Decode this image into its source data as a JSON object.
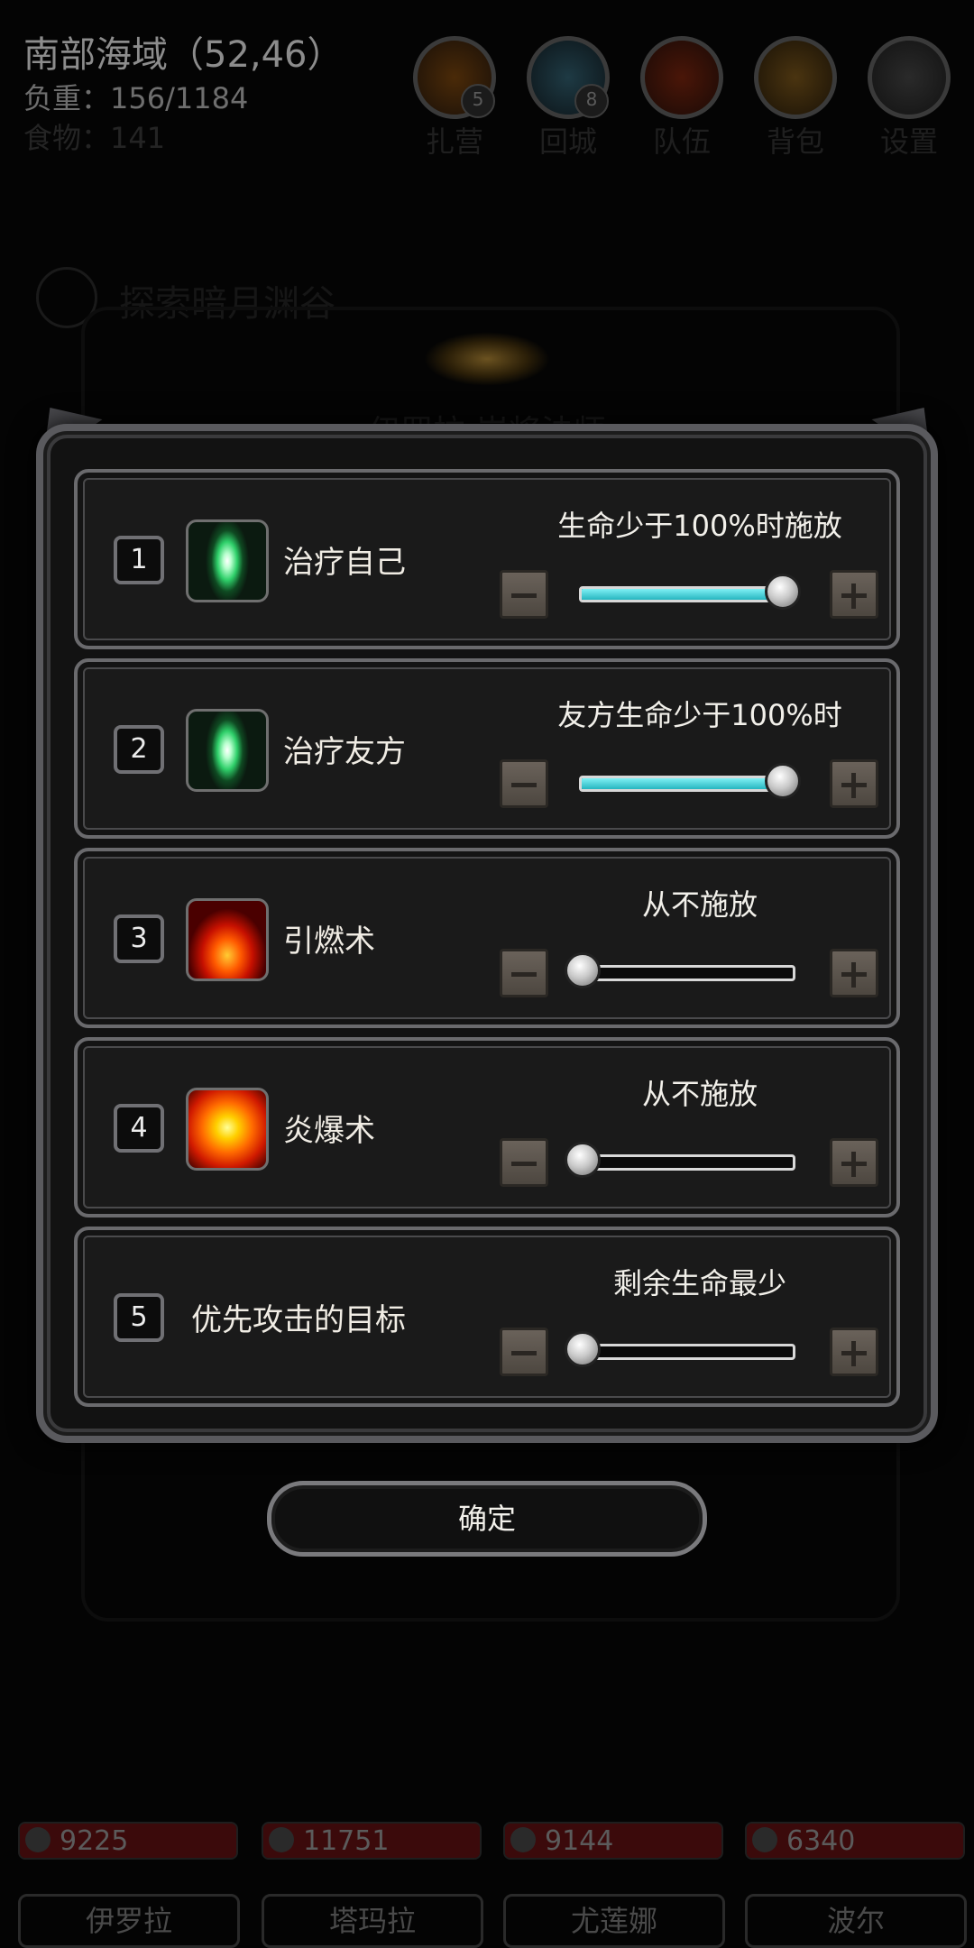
{
  "hud": {
    "location": "南部海域（52,46）",
    "load": "负重：156/1184",
    "food": "食物：141",
    "buttons": [
      {
        "label": "扎营",
        "badge": "5"
      },
      {
        "label": "回城",
        "badge": "8"
      },
      {
        "label": "队伍",
        "badge": ""
      },
      {
        "label": "背包",
        "badge": ""
      },
      {
        "label": "设置",
        "badge": ""
      }
    ]
  },
  "quest": {
    "text": "探索暗月渊谷"
  },
  "behind_title": "伊罗拉 岸将法师",
  "rules": [
    {
      "num": "1",
      "name": "治疗自己",
      "condition": "生命少于100%时施放",
      "level": 1.0,
      "icon": "heal-icon"
    },
    {
      "num": "2",
      "name": "治疗友方",
      "condition": "友方生命少于100%时",
      "level": 1.0,
      "icon": "heal-icon"
    },
    {
      "num": "3",
      "name": "引燃术",
      "condition": "从不施放",
      "level": 0.0,
      "icon": "ignite-icon"
    },
    {
      "num": "4",
      "name": "炎爆术",
      "condition": "从不施放",
      "level": 0.0,
      "icon": "fire-blast-icon"
    },
    {
      "num": "5",
      "name": "优先攻击的目标",
      "condition": "剩余生命最少",
      "level": 0.0,
      "icon": ""
    }
  ],
  "confirm_label": "确定",
  "party": [
    {
      "hp": "9225",
      "name": "伊罗拉"
    },
    {
      "hp": "11751",
      "name": "塔玛拉"
    },
    {
      "hp": "9144",
      "name": "尤莲娜"
    },
    {
      "hp": "6340",
      "name": "波尔"
    }
  ]
}
